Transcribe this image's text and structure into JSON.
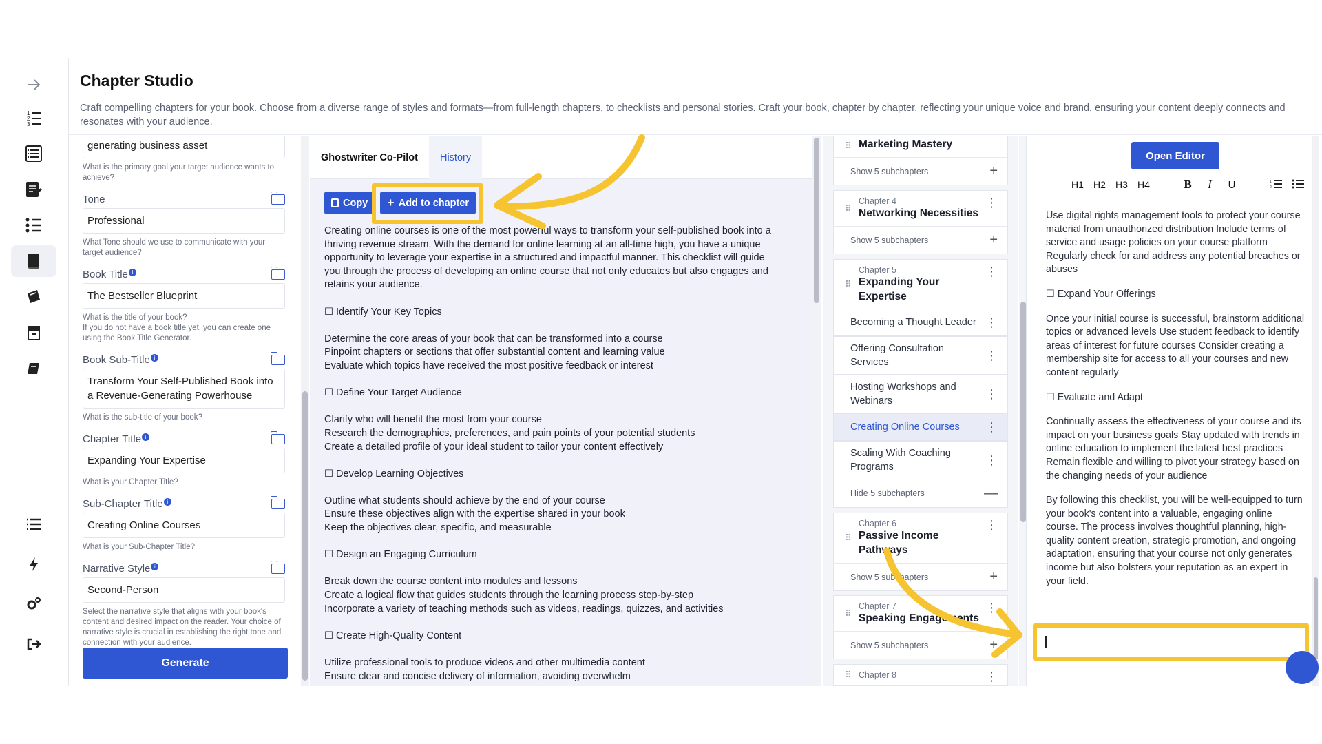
{
  "header": {
    "title": "Chapter Studio",
    "description": "Craft compelling chapters for your book. Choose from a diverse range of styles and formats—from full-length chapters, to checklists and personal stories. Craft your book, chapter by chapter, reflecting your unique voice and brand, ensuring your content deeply connects and resonates with your audience."
  },
  "rail": {
    "icons": [
      "arrow-right-icon",
      "numbered-list-icon",
      "book-list-icon",
      "note-edit-icon",
      "checklist-icon",
      "book-active-icon",
      "magic-book-icon",
      "archive-icon",
      "flag-book-icon",
      "menu-list-icon",
      "bolt-icon",
      "settings-icon",
      "logout-icon"
    ]
  },
  "form": {
    "goal_value": "generating business asset",
    "goal_help": "What is the primary goal your target audience wants to achieve?",
    "tone_label": "Tone",
    "tone_value": "Professional",
    "tone_help": "What Tone should we use to communicate with your target audience?",
    "book_title_label": "Book Title",
    "book_title_value": "The Bestseller Blueprint",
    "book_title_help": "What is the title of your book?\nIf you do not have a book title yet, you can create one using the Book Title Generator.",
    "book_subtitle_label": "Book Sub-Title",
    "book_subtitle_value": "Transform Your Self-Published Book into a Revenue-Generating Powerhouse",
    "book_subtitle_help": "What is the sub-title of your book?",
    "chapter_title_label": "Chapter Title",
    "chapter_title_value": "Expanding Your Expertise",
    "chapter_title_help": "What is your Chapter Title?",
    "subchapter_title_label": "Sub-Chapter Title",
    "subchapter_title_value": "Creating Online Courses",
    "subchapter_title_help": "What is your Sub-Chapter Title?",
    "narrative_label": "Narrative Style",
    "narrative_value": "Second-Person",
    "narrative_help": "Select the narrative style that aligns with your book's content and desired impact on the reader. Your choice of narrative style is crucial in establishing the right tone and connection with your audience.",
    "generate_label": "Generate"
  },
  "copilot": {
    "tab_ghostwriter": "Ghostwriter Co-Pilot",
    "tab_history": "History",
    "copy_label": "Copy",
    "add_label": "Add to chapter",
    "paragraphs": [
      [
        "Creating online courses is one of the most powerful ways to transform your self-published book into a",
        "thriving revenue stream. With the demand for online learning at an all-time high, you have a unique",
        "opportunity to leverage your expertise in a structured and impactful manner. This checklist will guide",
        "you through the process of developing an online course that not only educates but also engages and",
        "retains your audience."
      ],
      [
        "☐ Identify Your Key Topics"
      ],
      [
        "Determine the core areas of your book that can be transformed into a course",
        "Pinpoint chapters or sections that offer substantial content and learning value",
        "Evaluate which topics have received the most positive feedback or interest"
      ],
      [
        "☐ Define Your Target Audience"
      ],
      [
        "Clarify who will benefit the most from your course",
        "Research the demographics, preferences, and pain points of your potential students",
        "Create a detailed profile of your ideal student to tailor your content effectively"
      ],
      [
        "☐ Develop Learning Objectives"
      ],
      [
        "Outline what students should achieve by the end of your course",
        "Ensure these objectives align with the expertise shared in your book",
        "Keep the objectives clear, specific, and measurable"
      ],
      [
        "☐ Design an Engaging Curriculum"
      ],
      [
        "Break down the course content into modules and lessons",
        "Create a logical flow that guides students through the learning process step-by-step",
        "Incorporate a variety of teaching methods such as videos, readings, quizzes, and activities"
      ],
      [
        "☐ Create High-Quality Content"
      ],
      [
        "Utilize professional tools to produce videos and other multimedia content",
        "Ensure clear and concise delivery of information, avoiding overwhelm"
      ]
    ]
  },
  "chapters": {
    "marketing_title": "Marketing Mastery",
    "show_5": "Show 5 subchapters",
    "hide_5": "Hide 5 subchapters",
    "ch4_num": "Chapter 4",
    "ch4_title": "Networking Necessities",
    "ch5_num": "Chapter 5",
    "ch5_title": "Expanding Your Expertise",
    "sub1": "Becoming a Thought Leader",
    "sub2": "Offering Consultation Services",
    "sub3": "Hosting Workshops and Webinars",
    "sub4": "Creating Online Courses",
    "sub5": "Scaling With Coaching Programs",
    "ch6_num": "Chapter 6",
    "ch6_title": "Passive Income Pathways",
    "ch7_num": "Chapter 7",
    "ch7_title": "Speaking Engagements",
    "ch8_num": "Chapter 8"
  },
  "editor": {
    "open_editor": "Open Editor",
    "toolbar": [
      "H1",
      "H2",
      "H3",
      "H4",
      "B",
      "I",
      "U",
      "ordered-list-icon",
      "bullet-list-icon"
    ],
    "paragraphs": [
      "Use digital rights management tools to protect your course material from unauthorized distribution Include terms of service and usage policies on your course platform Regularly check for and address any potential breaches or abuses",
      "☐ Expand Your Offerings",
      "Once your initial course is successful, brainstorm additional topics or advanced levels Use student feedback to identify areas of interest for future courses Consider creating a membership site for access to all your courses and new content regularly",
      "☐ Evaluate and Adapt",
      "Continually assess the effectiveness of your course and its impact on your business goals Stay updated with trends in online education to implement the latest best practices Remain flexible and willing to pivot your strategy based on the changing needs of your audience",
      "By following this checklist, you will be well-equipped to turn your book's content into a valuable, engaging online course. The process involves thoughtful planning, high-quality content creation, strategic promotion, and ongoing adaptation, ensuring that your course not only generates income but also bolsters your reputation as an expert in your field."
    ]
  },
  "colors": {
    "accent": "#2f57d3",
    "highlight": "#f5c430"
  }
}
